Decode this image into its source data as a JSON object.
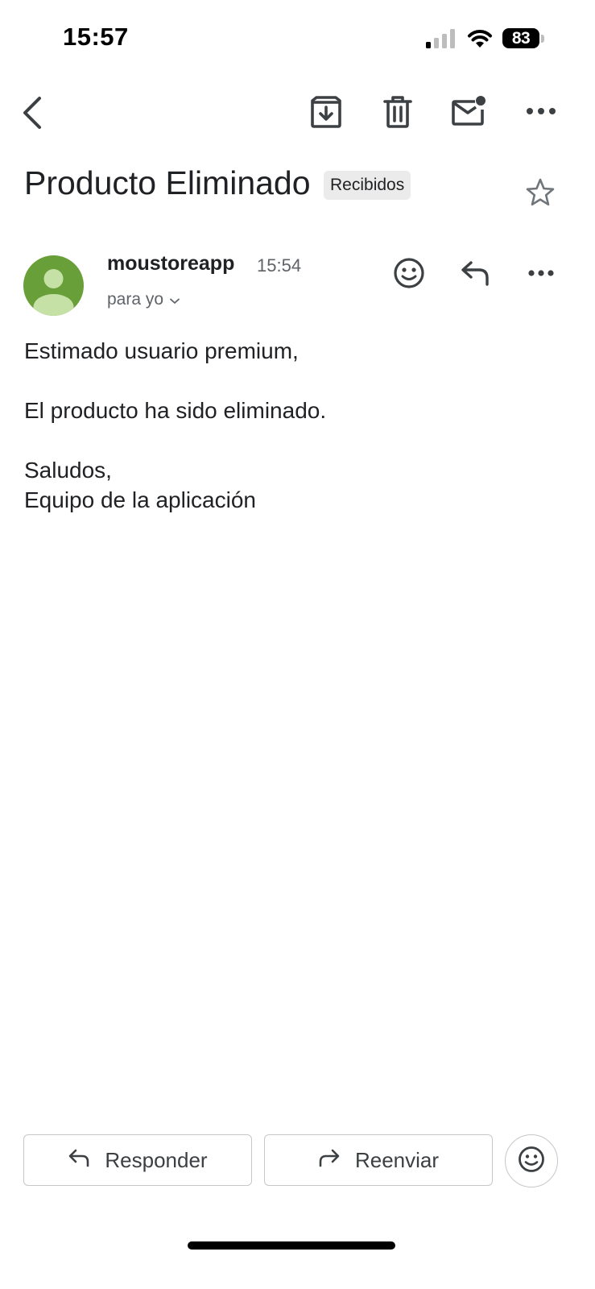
{
  "status_bar": {
    "time": "15:57",
    "battery": "83",
    "icons": [
      "cellular-signal-icon",
      "wifi-icon",
      "battery-icon"
    ]
  },
  "toolbar": {
    "icons": [
      "back-icon",
      "archive-icon",
      "trash-icon",
      "mark-unread-icon",
      "more-icon"
    ]
  },
  "email": {
    "subject": "Producto Eliminado",
    "label": "Recibidos",
    "sender": "moustoreapp",
    "time": "15:54",
    "recipient": "para yo",
    "body": {
      "line1": "Estimado usuario premium,",
      "line2": "El producto ha sido eliminado.",
      "line3": "Saludos,",
      "line4": "Equipo de la aplicación"
    }
  },
  "actions": {
    "reply": "Responder",
    "forward": "Reenviar"
  },
  "colors": {
    "avatar": "#689f38",
    "text": "#202124",
    "secondary": "#5f6368",
    "chip": "#ebebeb",
    "border": "#c7c7c7"
  }
}
